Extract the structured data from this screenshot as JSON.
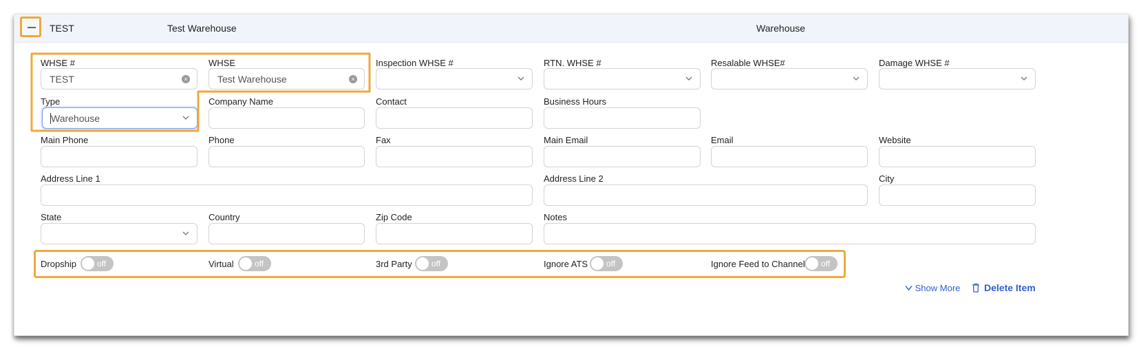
{
  "header": {
    "code": "TEST",
    "name": "Test Warehouse",
    "type": "Warehouse"
  },
  "fields": {
    "whse_num": {
      "label": "WHSE #",
      "value": "TEST"
    },
    "whse": {
      "label": "WHSE",
      "value": "Test Warehouse"
    },
    "inspection_whse": {
      "label": "Inspection WHSE #",
      "value": ""
    },
    "rtn_whse": {
      "label": "RTN. WHSE #",
      "value": ""
    },
    "resalable_whse": {
      "label": "Resalable WHSE#",
      "value": ""
    },
    "damage_whse": {
      "label": "Damage WHSE #",
      "value": ""
    },
    "type": {
      "label": "Type",
      "value": "Warehouse"
    },
    "company_name": {
      "label": "Company Name",
      "value": ""
    },
    "contact": {
      "label": "Contact",
      "value": ""
    },
    "business_hours": {
      "label": "Business Hours",
      "value": ""
    },
    "main_phone": {
      "label": "Main Phone",
      "value": ""
    },
    "phone": {
      "label": "Phone",
      "value": ""
    },
    "fax": {
      "label": "Fax",
      "value": ""
    },
    "main_email": {
      "label": "Main Email",
      "value": ""
    },
    "email": {
      "label": "Email",
      "value": ""
    },
    "website": {
      "label": "Website",
      "value": ""
    },
    "address1": {
      "label": "Address Line 1",
      "value": ""
    },
    "address2": {
      "label": "Address Line 2",
      "value": ""
    },
    "city": {
      "label": "City",
      "value": ""
    },
    "state": {
      "label": "State",
      "value": ""
    },
    "country": {
      "label": "Country",
      "value": ""
    },
    "zip": {
      "label": "Zip Code",
      "value": ""
    },
    "notes": {
      "label": "Notes",
      "value": ""
    }
  },
  "toggles": {
    "dropship": {
      "label": "Dropship",
      "state": "off"
    },
    "virtual": {
      "label": "Virtual",
      "state": "off"
    },
    "third_party": {
      "label": "3rd Party",
      "state": "off"
    },
    "ignore_ats": {
      "label": "Ignore ATS",
      "state": "off"
    },
    "ignore_feed": {
      "label": "Ignore Feed to Channel",
      "state": "off"
    }
  },
  "actions": {
    "show_more": "Show More",
    "delete_item": "Delete Item"
  },
  "colors": {
    "highlight": "#f0a83a",
    "link": "#2f5fd0",
    "header_bg": "#f1f4fb"
  }
}
